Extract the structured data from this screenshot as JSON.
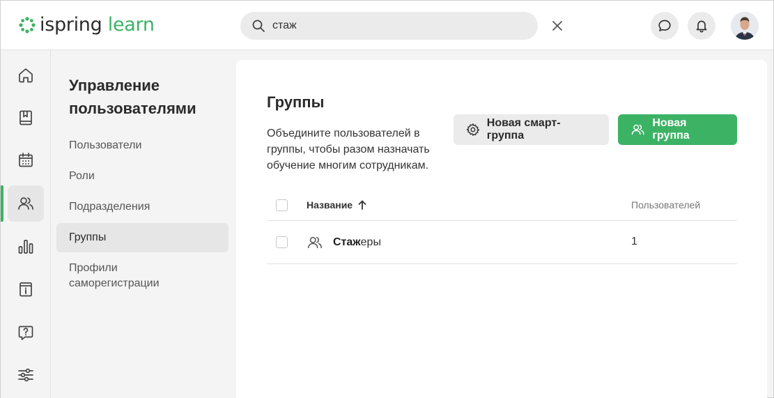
{
  "header": {
    "logo_ispring": "ispring",
    "logo_learn": "learn",
    "search_value": "стаж",
    "accent_color": "#3cb265"
  },
  "rail": {
    "items": [
      {
        "icon": "home-icon"
      },
      {
        "icon": "book-icon"
      },
      {
        "icon": "calendar-icon"
      },
      {
        "icon": "users-icon",
        "active": true
      },
      {
        "icon": "bar-chart-icon"
      },
      {
        "icon": "info-icon"
      },
      {
        "icon": "help-icon"
      },
      {
        "icon": "settings-sliders-icon"
      }
    ]
  },
  "subnav": {
    "title": "Управление пользователями",
    "items": [
      {
        "label": "Пользователи"
      },
      {
        "label": "Роли"
      },
      {
        "label": "Подразделения"
      },
      {
        "label": "Группы",
        "active": true
      },
      {
        "label": "Профили саморегистрации"
      }
    ]
  },
  "main": {
    "title": "Группы",
    "description": "Объедините пользователей в группы, чтобы разом назначать обучение многим сотрудникам.",
    "smart_group_button": "Новая смарт-группа",
    "new_group_button": "Новая группа",
    "table": {
      "columns": {
        "name": "Название",
        "users": "Пользователей"
      },
      "rows": [
        {
          "name_match": "Стаж",
          "name_rest": "еры",
          "users": "1"
        }
      ]
    }
  }
}
